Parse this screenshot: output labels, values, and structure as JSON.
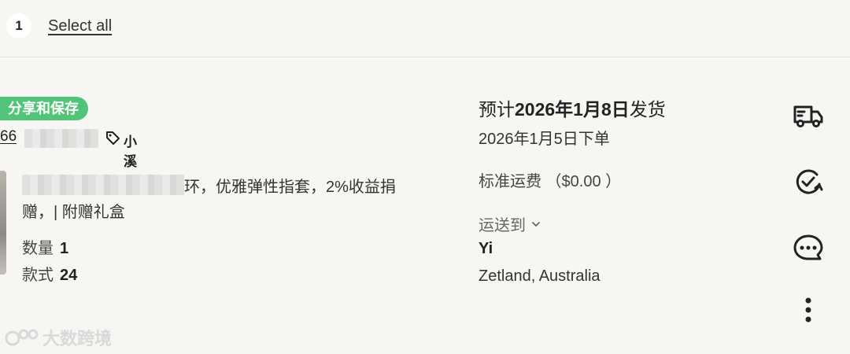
{
  "header": {
    "selected_count": "1",
    "select_all_label": "Select all"
  },
  "order": {
    "badge_label": "分享和保存",
    "shop_id": "66",
    "shop_name": "小溪",
    "product_title_line1": "环，优雅弹性指套，2%收益捐",
    "product_title_line2": "赠，| 附赠礼盒",
    "quantity_label": "数量",
    "quantity_value": "1",
    "style_label": "款式",
    "style_value": "24"
  },
  "shipping": {
    "eta_prefix": "预计",
    "eta_date": "2026年1月8日",
    "eta_suffix": "发货",
    "order_date": "2026年1月5日下单",
    "fee_text": "标准运费 （$0.00 ）",
    "ship_to_label": "运送到",
    "recipient_name": "Yi",
    "address": "Zetland, Australia"
  },
  "icons": {
    "truck": "truck-icon",
    "track": "check-arrow-icon",
    "message": "message-icon",
    "more": "more-icon",
    "tag": "tag-icon",
    "chevron": "chevron-down-icon"
  },
  "watermark": {
    "text": "大数跨境"
  },
  "colors": {
    "badge_green": "#52c47a",
    "background": "#f7f6f3"
  }
}
